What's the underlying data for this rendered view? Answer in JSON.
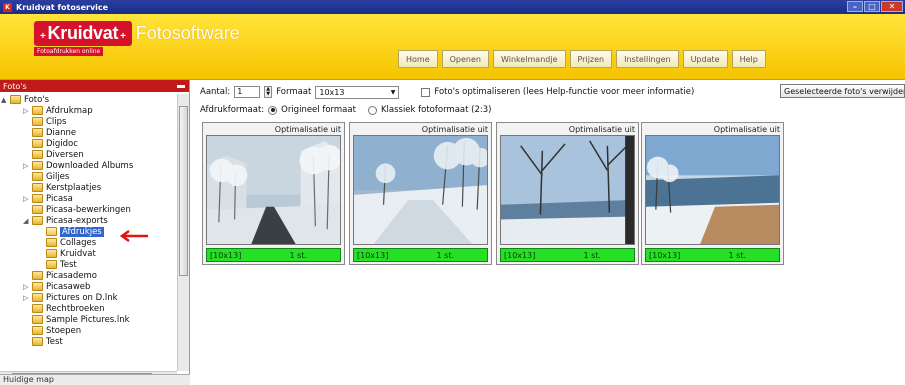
{
  "window": {
    "title": "Kruidvat fotoservice"
  },
  "header": {
    "logo_brand": "Kruidvat",
    "logo_suffix": "Fotosoftware",
    "tagline": "Fotoafdrukken online",
    "nav": [
      "Home",
      "Openen",
      "Winkelmandje",
      "Prijzen",
      "Instellingen",
      "Update",
      "Help"
    ]
  },
  "sidebar": {
    "title": "Foto's",
    "tree": [
      {
        "label": "Foto's",
        "depth": 0,
        "expander": "▲"
      },
      {
        "label": "Afdrukmap",
        "depth": 1,
        "expander": "▷"
      },
      {
        "label": "Clips",
        "depth": 1
      },
      {
        "label": "Dianne",
        "depth": 1
      },
      {
        "label": "Digidoc",
        "depth": 1
      },
      {
        "label": "Diversen",
        "depth": 1
      },
      {
        "label": "Downloaded Albums",
        "depth": 1,
        "expander": "▷"
      },
      {
        "label": "Giljes",
        "depth": 1
      },
      {
        "label": "Kerstplaatjes",
        "depth": 1
      },
      {
        "label": "Picasa",
        "depth": 1,
        "expander": "▷"
      },
      {
        "label": "Picasa-bewerkingen",
        "depth": 1
      },
      {
        "label": "Picasa-exports",
        "depth": 1,
        "expander": "◢"
      },
      {
        "label": "Afdrukjes",
        "depth": 2,
        "selected": true
      },
      {
        "label": "Collages",
        "depth": 2
      },
      {
        "label": "Kruidvat",
        "depth": 2
      },
      {
        "label": "Test",
        "depth": 2
      },
      {
        "label": "Picasademo",
        "depth": 1
      },
      {
        "label": "Picasaweb",
        "depth": 1,
        "expander": "▷"
      },
      {
        "label": "Pictures on D.lnk",
        "depth": 1,
        "expander": "▷"
      },
      {
        "label": "Rechtbroeken",
        "depth": 1
      },
      {
        "label": "Sample Pictures.lnk",
        "depth": 1
      },
      {
        "label": "Stoepen",
        "depth": 1
      },
      {
        "label": "Test",
        "depth": 1
      }
    ],
    "status": "Huidige map"
  },
  "toolbar": {
    "aantal_label": "Aantal:",
    "aantal_value": "1",
    "formaat_label": "Formaat",
    "formaat_value": "10x13",
    "optimize_label": "Foto's optimaliseren  (lees Help-functie voor meer informatie)",
    "delete_label": "Geselecteerde foto's verwijderen",
    "afdruk_label": "Afdrukformaat:",
    "radio_original": "Origineel formaat",
    "radio_classic": "Klassiek fotoformaat (2:3)"
  },
  "photos": [
    {
      "opt": "Optimalisatie uit",
      "format": "[10x13]",
      "qty": "1 st."
    },
    {
      "opt": "Optimalisatie uit",
      "format": "[10x13]",
      "qty": "1 st."
    },
    {
      "opt": "Optimalisatie uit",
      "format": "[10x13]",
      "qty": "1 st."
    },
    {
      "opt": "Optimalisatie uit",
      "format": "[10x13]",
      "qty": "1 st."
    }
  ],
  "colors": {
    "header_yellow": "#f6c400",
    "brand_red": "#d6112b",
    "status_green": "#25e025",
    "selection_blue": "#3366cc"
  }
}
